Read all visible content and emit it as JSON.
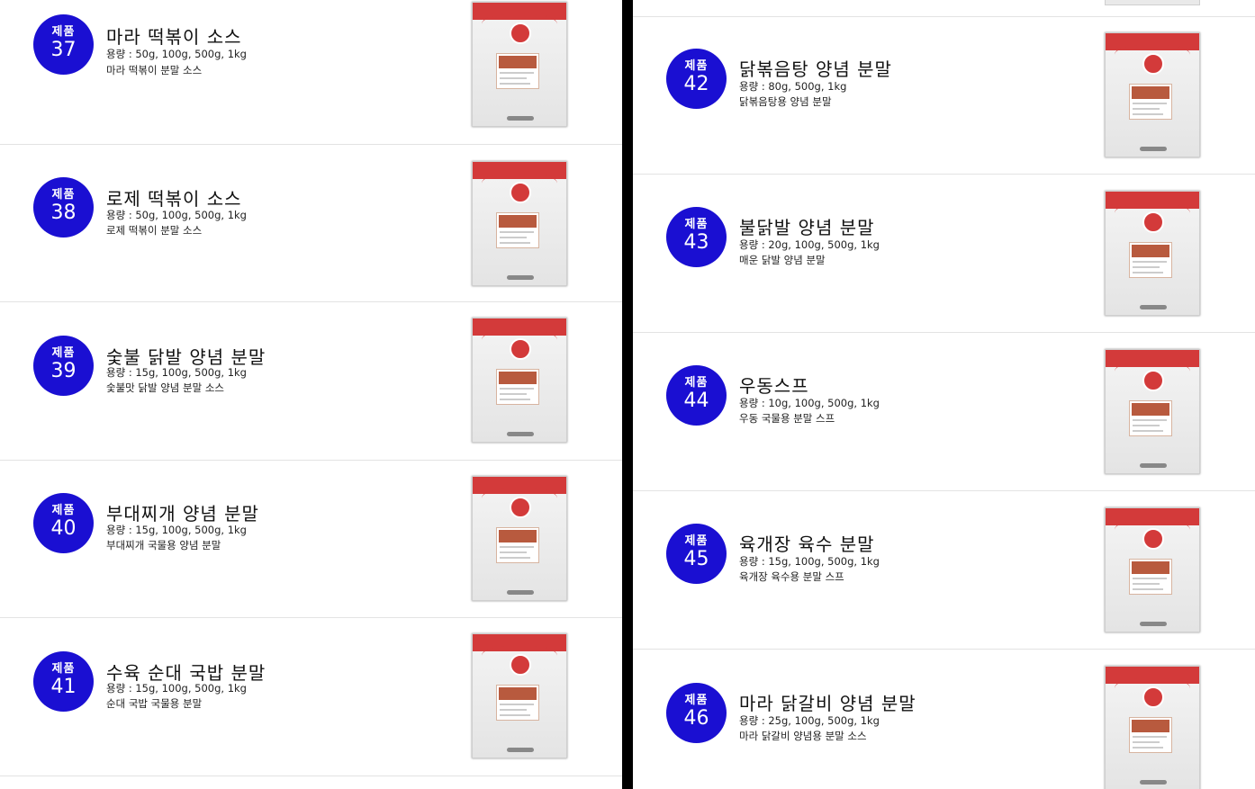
{
  "badge_label": "제품",
  "left_products": [
    {
      "number": "37",
      "name": "마라 떡볶이 소스",
      "capacity": "용량 : 50g, 100g, 500g, 1kg",
      "description": "마라 떡볶이 분말 소스"
    },
    {
      "number": "38",
      "name": "로제 떡볶이 소스",
      "capacity": "용량 : 50g, 100g, 500g, 1kg",
      "description": "로제 떡볶이 분말 소스"
    },
    {
      "number": "39",
      "name": "숯불 닭발 양념 분말",
      "capacity": "용량 : 15g, 100g, 500g, 1kg",
      "description": "숯불맛 닭발 양념 분말 소스"
    },
    {
      "number": "40",
      "name": "부대찌개 양념 분말",
      "capacity": "용량 : 15g, 100g, 500g, 1kg",
      "description": "부대찌개 국물용 양념 분말"
    },
    {
      "number": "41",
      "name": "수육 순대 국밥 분말",
      "capacity": "용량 : 15g, 100g, 500g, 1kg",
      "description": "순대 국밥 국물용 분말"
    }
  ],
  "right_products": [
    {
      "number": "42",
      "name": "닭볶음탕 양념 분말",
      "capacity": "용량 : 80g, 500g, 1kg",
      "description": "닭볶음탕용 양념 분말"
    },
    {
      "number": "43",
      "name": "불닭발 양념 분말",
      "capacity": "용량 : 20g, 100g, 500g, 1kg",
      "description": "매운 닭발 양념 분말"
    },
    {
      "number": "44",
      "name": "우동스프",
      "capacity": "용량 : 10g, 100g, 500g, 1kg",
      "description": "우동 국물용 분말 스프"
    },
    {
      "number": "45",
      "name": "육개장 육수 분말",
      "capacity": "용량 : 15g, 100g, 500g, 1kg",
      "description": "육개장 육수용 분말 스프"
    },
    {
      "number": "46",
      "name": "마라 닭갈비 양념 분말",
      "capacity": "용량 : 25g, 100g, 500g, 1kg",
      "description": "마라 닭갈비 양념용 분말 소스"
    }
  ],
  "colors": {
    "badge": "#1a0fd2",
    "pouch_accent": "#d33a3a",
    "divider": "#e3e3e3"
  },
  "icons": {
    "product_image": "sauce-pouch-image"
  }
}
